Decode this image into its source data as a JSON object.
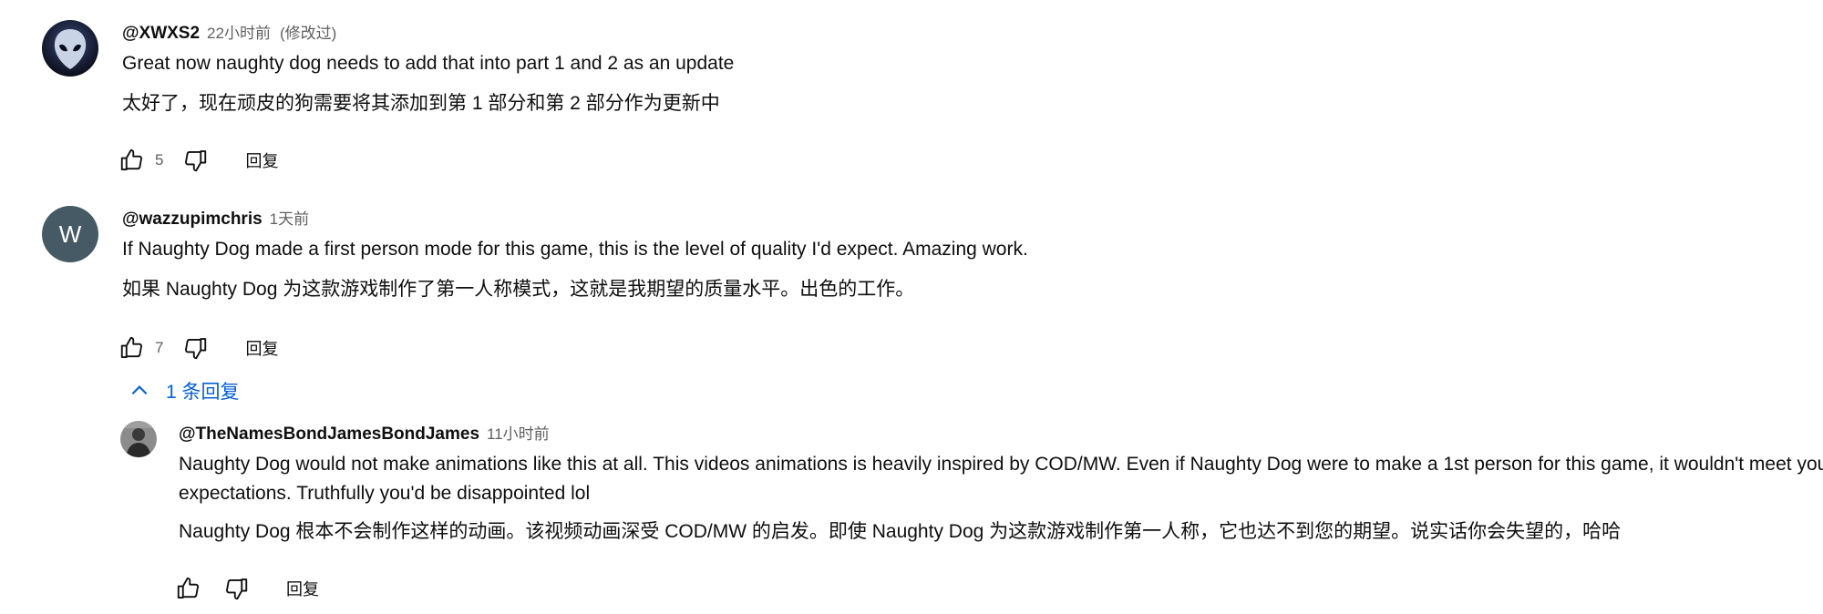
{
  "comments": [
    {
      "author": "@XWXS2",
      "time": "22小时前",
      "edited": "(修改过)",
      "text": "Great now naughty dog needs to add that into part 1 and 2 as an update",
      "translation": "太好了，现在顽皮的狗需要将其添加到第 1 部分和第 2 部分作为更新中",
      "likes": "5",
      "reply_label": "回复",
      "avatar_icon": "alien-head-icon"
    },
    {
      "author": "@wazzupimchris",
      "time": "1天前",
      "avatar_letter": "W",
      "text": "If Naughty Dog made a first person mode for this game, this is the level of quality I'd expect. Amazing work.",
      "translation": "如果 Naughty Dog 为这款游戏制作了第一人称模式，这就是我期望的质量水平。出色的工作。",
      "likes": "7",
      "reply_label": "回复",
      "replies_toggle": "1 条回复"
    }
  ],
  "reply": {
    "author": "@TheNamesBondJamesBondJames",
    "time": "11小时前",
    "text": "Naughty Dog would not make animations like this at all. This videos animations is heavily inspired by COD/MW. Even if Naughty Dog were to make a 1st person for this game, it wouldn't meet your expectations. Truthfully you'd be disappointed lol",
    "translation": "Naughty Dog 根本不会制作这样的动画。该视频动画深受 COD/MW 的启发。即使 Naughty Dog 为这款游戏制作第一人称，它也达不到您的期望。说实话你会失望的，哈哈",
    "reply_label": "回复",
    "avatar_icon": "person-photo-icon"
  },
  "colors": {
    "text": "#0f0f0f",
    "secondary": "#606060",
    "link": "#065fd4",
    "avatar_letter_bg": "#455a64"
  }
}
